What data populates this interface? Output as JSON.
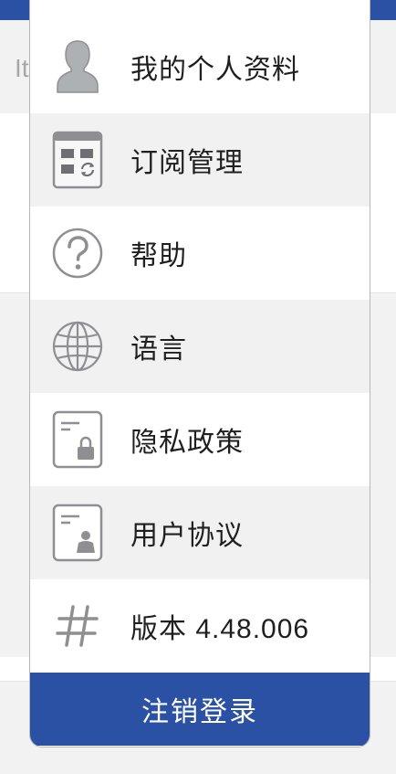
{
  "background": {
    "peek_text": "It"
  },
  "menu": {
    "items": [
      {
        "label": "我的个人资料",
        "icon": "user-profile-icon"
      },
      {
        "label": "订阅管理",
        "icon": "subscription-icon"
      },
      {
        "label": "帮助",
        "icon": "help-icon"
      },
      {
        "label": "语言",
        "icon": "globe-icon"
      },
      {
        "label": "隐私政策",
        "icon": "privacy-document-icon"
      },
      {
        "label": "用户协议",
        "icon": "user-agreement-icon"
      },
      {
        "label": "版本 4.48.006",
        "icon": "hash-icon"
      }
    ],
    "logout_label": "注销登录"
  },
  "colors": {
    "accent": "#2a51a3",
    "icon_gray": "#8e8e93",
    "row_shade": "#f1f1f1"
  }
}
